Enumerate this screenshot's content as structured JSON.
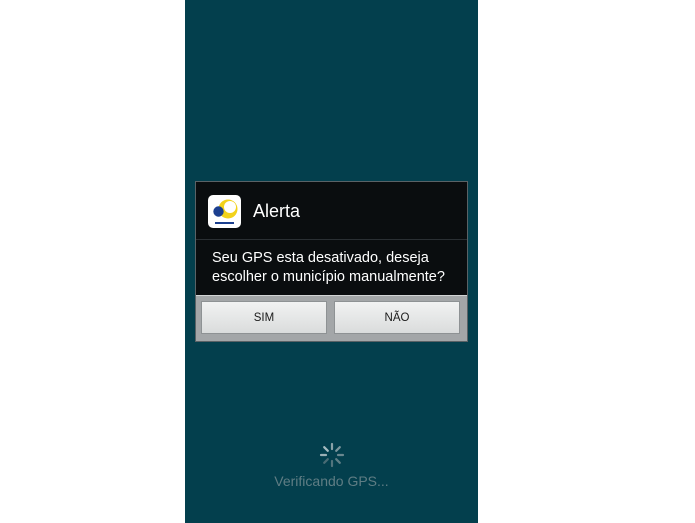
{
  "dialog": {
    "title": "Alerta",
    "message": "Seu GPS esta desativado, deseja escolher o município manualmente?",
    "buttons": {
      "positive_label": "SIM",
      "negative_label": "NÃO"
    },
    "app_icon": "anatel-logo-icon"
  },
  "loading": {
    "text": "Verificando GPS...",
    "icon": "spinner-icon"
  },
  "colors": {
    "screen_background": "#033f4d",
    "dialog_background": "#0a0d0f",
    "button_bar_background": "#a3a6a8",
    "loading_text": "#5f7d84"
  }
}
